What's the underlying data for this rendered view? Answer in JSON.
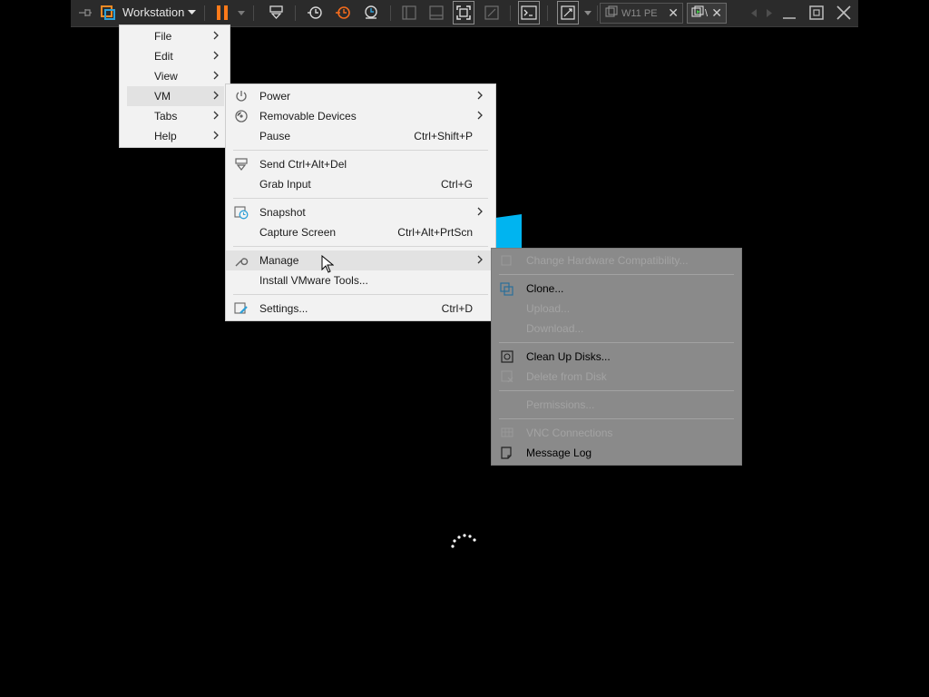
{
  "toolbar": {
    "workstation_label": "Workstation",
    "tabs": [
      {
        "label": "W11 PE",
        "close": "✕"
      },
      {
        "label": "\\",
        "close": "✕"
      }
    ]
  },
  "main_menu": {
    "items": [
      {
        "label": "File",
        "arrow": true
      },
      {
        "label": "Edit",
        "arrow": true
      },
      {
        "label": "View",
        "arrow": true
      },
      {
        "label": "VM",
        "arrow": true,
        "highlighted": true
      },
      {
        "label": "Tabs",
        "arrow": true
      },
      {
        "label": "Help",
        "arrow": true
      }
    ]
  },
  "vm_menu": {
    "items": [
      {
        "label": "Power",
        "icon": "power-icon",
        "arrow": true
      },
      {
        "label": "Removable Devices",
        "icon": "removable-devices-icon",
        "arrow": true
      },
      {
        "label": "Pause",
        "shortcut": "Ctrl+Shift+P"
      },
      {
        "label": "Send Ctrl+Alt+Del",
        "icon": "send-keys-icon"
      },
      {
        "label": "Grab Input",
        "shortcut": "Ctrl+G"
      },
      {
        "label": "Snapshot",
        "icon": "snapshot-icon",
        "arrow": true
      },
      {
        "label": "Capture Screen",
        "shortcut": "Ctrl+Alt+PrtScn"
      },
      {
        "label": "Manage",
        "icon": "wrench-icon",
        "arrow": true,
        "highlighted": true
      },
      {
        "label": "Install VMware Tools..."
      },
      {
        "label": "Settings...",
        "icon": "settings-icon",
        "shortcut": "Ctrl+D"
      }
    ]
  },
  "manage_menu": {
    "items": [
      {
        "label": "Change Hardware Compatibility...",
        "disabled": true
      },
      {
        "label": "Clone...",
        "icon": "clone-icon",
        "disabled": false
      },
      {
        "label": "Upload...",
        "disabled": true
      },
      {
        "label": "Download...",
        "disabled": true
      },
      {
        "label": "Clean Up Disks...",
        "icon": "clean-disk-icon",
        "disabled": false
      },
      {
        "label": "Delete from Disk",
        "disabled": true
      },
      {
        "label": "Permissions...",
        "disabled": true
      },
      {
        "label": "VNC Connections",
        "disabled": true
      },
      {
        "label": "Message Log",
        "icon": "message-log-icon",
        "disabled": false
      }
    ]
  },
  "colors": {
    "toolbar_bg": "#2b2b2b",
    "menu_bg": "#f2f2f2",
    "submenu_dim_bg": "#8a8a8a",
    "pause_orange": "#ff7a1a",
    "snapshot_orange": "#f26b1d",
    "accent_blue": "#2da0d8",
    "windows_logo": "#00b4f0"
  }
}
